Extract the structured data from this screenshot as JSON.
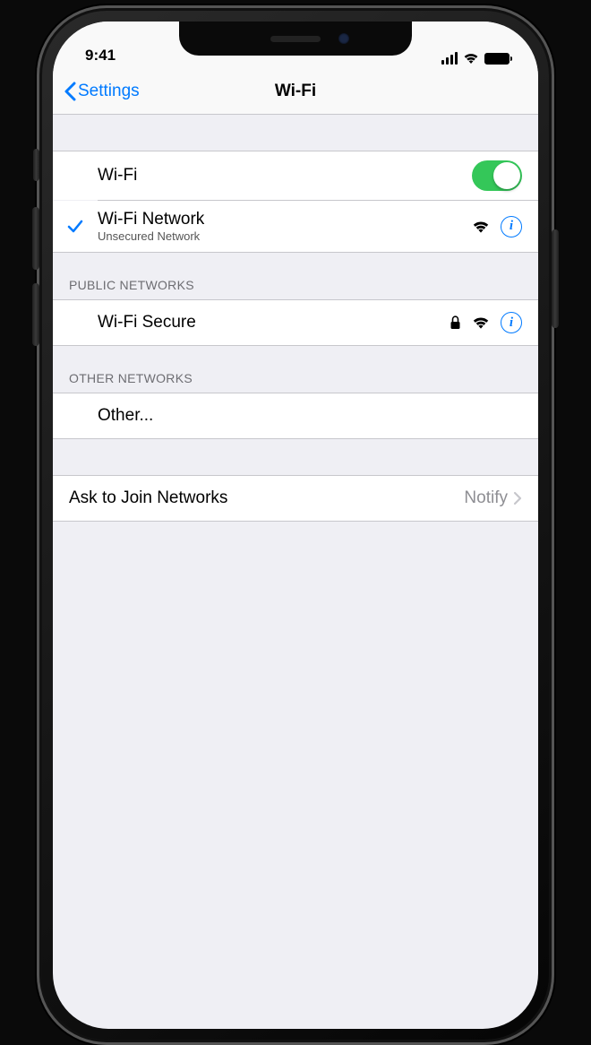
{
  "status": {
    "time": "9:41"
  },
  "nav": {
    "back": "Settings",
    "title": "Wi-Fi"
  },
  "wifi_toggle": {
    "label": "Wi-Fi",
    "on": true
  },
  "connected": {
    "name": "Wi-Fi Network",
    "subtitle": "Unsecured Network"
  },
  "sections": {
    "public_header": "PUBLIC NETWORKS",
    "other_header": "OTHER NETWORKS"
  },
  "public_networks": [
    {
      "name": "Wi-Fi Secure",
      "secured": true
    }
  ],
  "other_label": "Other...",
  "ask_join": {
    "label": "Ask to Join Networks",
    "value": "Notify"
  }
}
